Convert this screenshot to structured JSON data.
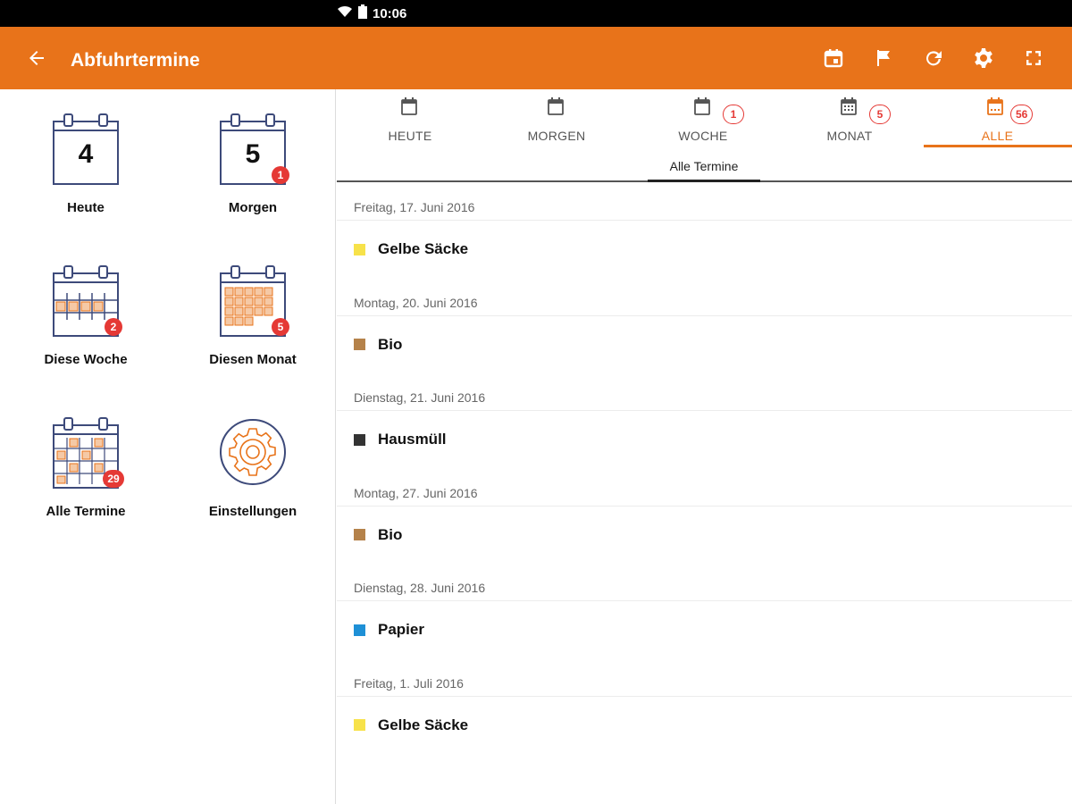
{
  "status_bar": {
    "time": "10:06",
    "icons": [
      "wifi-icon",
      "battery-icon"
    ]
  },
  "app_bar": {
    "title": "Abfuhrtermine",
    "back_icon": "arrow-left-icon",
    "actions": [
      "calendar-event-icon",
      "flag-icon",
      "refresh-icon",
      "settings-icon",
      "fullscreen-icon"
    ]
  },
  "tiles": [
    {
      "label": "Heute",
      "number": "4"
    },
    {
      "label": "Morgen",
      "number": "5",
      "badge": "1"
    },
    {
      "label": "Diese Woche",
      "badge": "2"
    },
    {
      "label": "Diesen Monat",
      "badge": "5"
    },
    {
      "label": "Alle Termine",
      "badge": "29"
    },
    {
      "label": "Einstellungen"
    }
  ],
  "tabs": [
    {
      "label": "HEUTE"
    },
    {
      "label": "MORGEN"
    },
    {
      "label": "WOCHE",
      "badge": "1"
    },
    {
      "label": "MONAT",
      "badge": "5"
    },
    {
      "label": "ALLE",
      "badge": "56",
      "active": true
    }
  ],
  "subtab": {
    "label": "Alle Termine"
  },
  "colors": {
    "accent": "#e8731a",
    "badge": "#e53935"
  },
  "entries": [
    {
      "date": "Freitag, 17. Juni 2016",
      "name": "Gelbe Säcke",
      "color": "#f7e24a"
    },
    {
      "date": "Montag, 20. Juni 2016",
      "name": "Bio",
      "color": "#b5824a"
    },
    {
      "date": "Dienstag, 21. Juni 2016",
      "name": "Hausmüll",
      "color": "#333333"
    },
    {
      "date": "Montag, 27. Juni 2016",
      "name": "Bio",
      "color": "#b5824a"
    },
    {
      "date": "Dienstag, 28. Juni 2016",
      "name": "Papier",
      "color": "#1e90d6"
    },
    {
      "date": "Freitag, 1. Juli 2016",
      "name": "Gelbe Säcke",
      "color": "#f7e24a"
    }
  ]
}
